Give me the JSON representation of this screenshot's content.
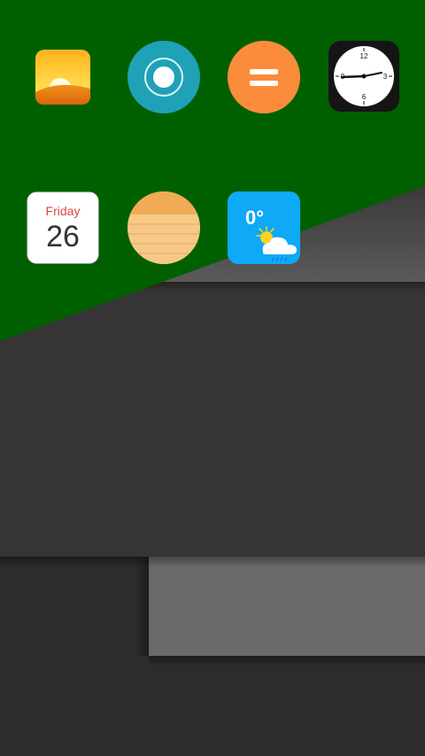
{
  "colors": {
    "wallpaper_green": "#006000",
    "wallpaper_dark": "#353535",
    "wallpaper_gray": "#6a6a6a"
  },
  "home_screen": {
    "apps": [
      {
        "icon": "sunrise-icon"
      },
      {
        "icon": "record-icon"
      },
      {
        "icon": "calculator-icon"
      },
      {
        "icon": "clock-icon"
      },
      {
        "icon": "calendar-icon",
        "day_label": "Friday",
        "date_number": "26"
      },
      {
        "icon": "notes-icon"
      },
      {
        "icon": "weather-icon",
        "temperature": "0°"
      }
    ]
  }
}
